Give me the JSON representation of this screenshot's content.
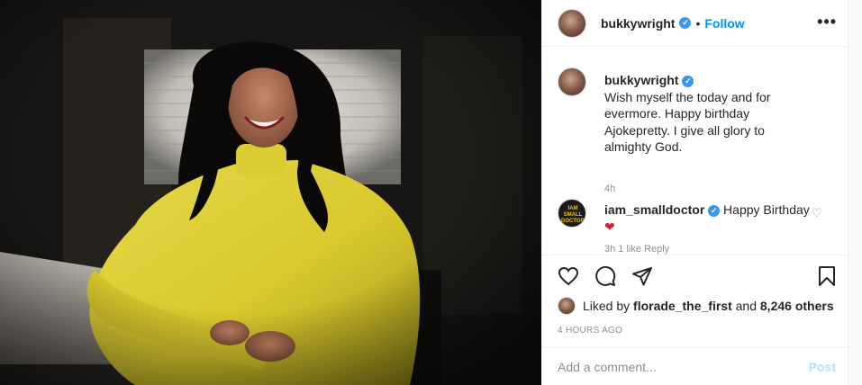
{
  "photo": {
    "icon": "woman-in-yellow-photo"
  },
  "header": {
    "username": "bukkywright",
    "separator": "•",
    "follow_label": "Follow",
    "more_icon": "•••"
  },
  "caption": {
    "username": "bukkywright",
    "text": "Wish myself the today and for evermore. Happy birthday Ajokepretty. I give all glory to almighty God.",
    "time": "4h"
  },
  "reply": {
    "username": "iam_smalldoctor",
    "text": "Happy Birthday",
    "heart": "❤",
    "meta": "3h   1 like   Reply",
    "avatar_text": "IAM SMALL DOCTOR"
  },
  "likes": {
    "prefix": "Liked by",
    "user": "florade_the_first",
    "and": "and",
    "count": "8,246 others"
  },
  "timestamp": "4 HOURS AGO",
  "add_comment": {
    "placeholder": "Add a comment...",
    "post_label": "Post"
  },
  "colors": {
    "accent": "#0095f6",
    "post_disabled": "#b2dffc",
    "verified": "#3897f0"
  }
}
